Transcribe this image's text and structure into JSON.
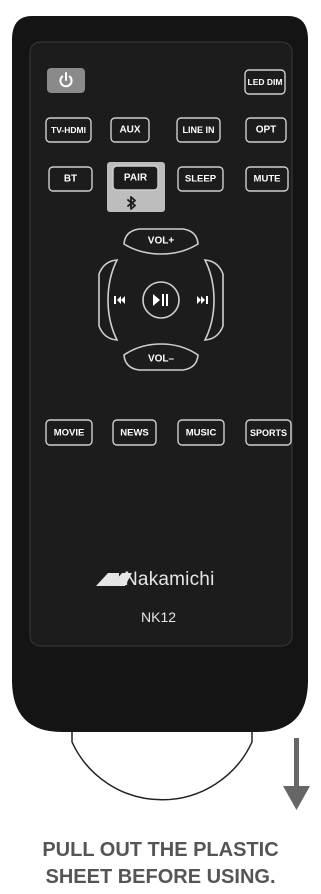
{
  "remote": {
    "buttons": {
      "power": "power-icon",
      "led_dim": "LED DIM",
      "tv_hdmi": "TV-HDMI",
      "aux": "AUX",
      "line_in": "LINE IN",
      "opt": "OPT",
      "bt": "BT",
      "pair": "PAIR",
      "pair_icon": "bluetooth-icon",
      "sleep": "SLEEP",
      "mute": "MUTE",
      "vol_up": "VOL+",
      "vol_down": "VOL–",
      "prev_icon": "previous-track-icon",
      "next_icon": "next-track-icon",
      "play_pause_icon": "play-pause-icon",
      "movie": "MOVIE",
      "news": "NEWS",
      "music": "MUSIC",
      "sports": "SPORTS"
    },
    "brand": "Nakamichi",
    "model": "NK12"
  },
  "notice": {
    "line1": "PULL OUT THE  PLASTIC",
    "line2": "SHEET  BEFORE USING."
  },
  "colors": {
    "body": "#141414",
    "panel": "#1d1d1d",
    "button_outline": "#cfcfcf",
    "pair_highlight": "#bdbdbd",
    "power_fill": "#8a8a8a",
    "notice_text": "#555555",
    "arrow": "#666666"
  }
}
